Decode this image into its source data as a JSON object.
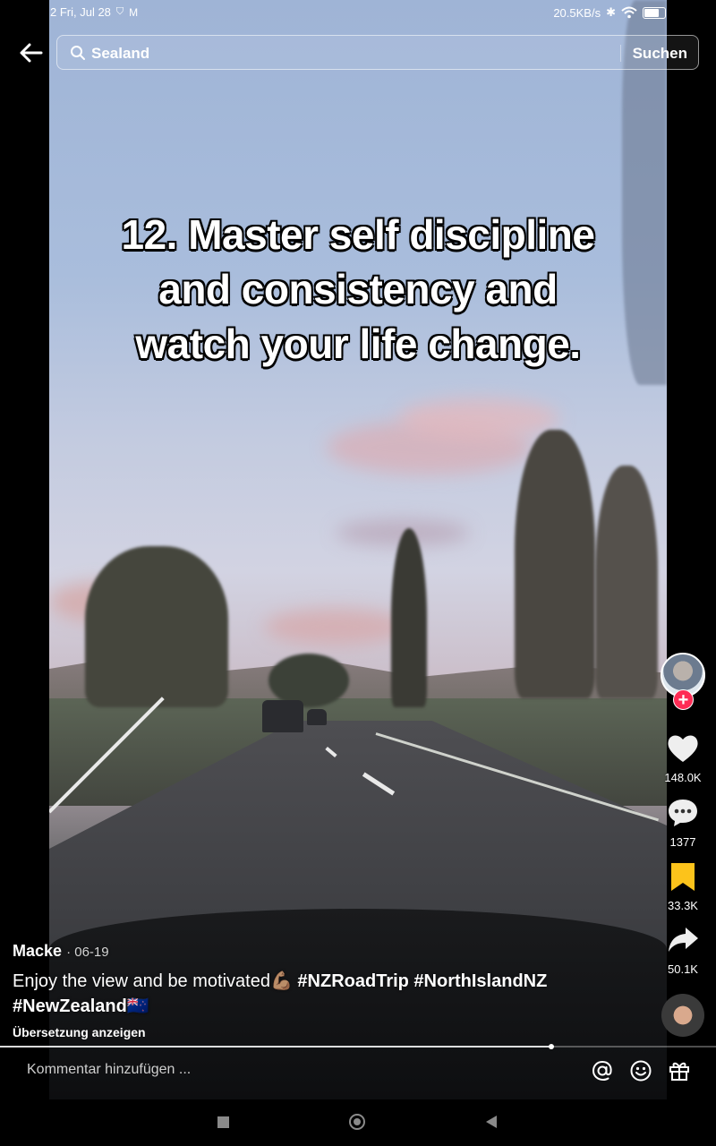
{
  "status_bar": {
    "time_date": "2 Fri, Jul 28",
    "network_speed": "20.5KB/s"
  },
  "search": {
    "query": "Sealand",
    "submit_label": "Suchen"
  },
  "video": {
    "caption_lines": [
      "12. Master self discipline",
      "and consistency and",
      "watch your life change."
    ]
  },
  "rail": {
    "likes": "148.0K",
    "comments": "1377",
    "saves": "33.3K",
    "shares": "50.1K"
  },
  "post": {
    "author": "Macke",
    "date": "· 06-19",
    "text_prefix": "Enjoy the view and be motivated💪🏽 ",
    "tags_line1": "#NZRoadTrip #NorthIslandNZ",
    "tags_line2": "#NewZealand🇳🇿",
    "translate": "Übersetzung anzeigen",
    "progress": 0.77
  },
  "comment_bar": {
    "placeholder": "Kommentar hinzufügen ..."
  },
  "colors": {
    "follow": "#fe2c55",
    "save": "#fcc31b"
  }
}
